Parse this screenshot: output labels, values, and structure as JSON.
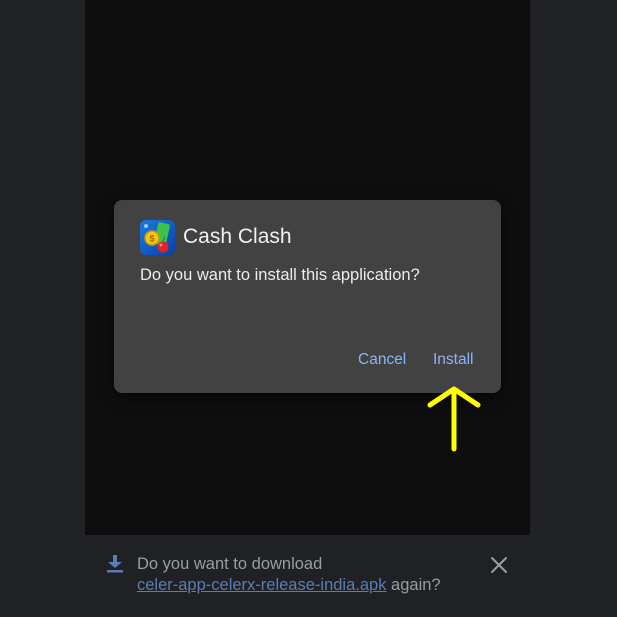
{
  "dialog": {
    "app_icon": "cash-clash-app-icon",
    "app_name": "Cash Clash",
    "message": "Do you want to install this application?",
    "cancel_label": "Cancel",
    "install_label": "Install"
  },
  "annotation": {
    "arrow_icon": "up-arrow-icon",
    "arrow_color": "#ffff00"
  },
  "download_bar": {
    "icon": "download-icon",
    "prefix": "Do you want to download",
    "filename": "celer-app-celerx-release-india.apk",
    "suffix": " again?",
    "close_icon": "close-icon"
  },
  "colors": {
    "dialog_bg": "#424242",
    "button_accent": "#8ab4f8",
    "link": "#5a7db4"
  }
}
